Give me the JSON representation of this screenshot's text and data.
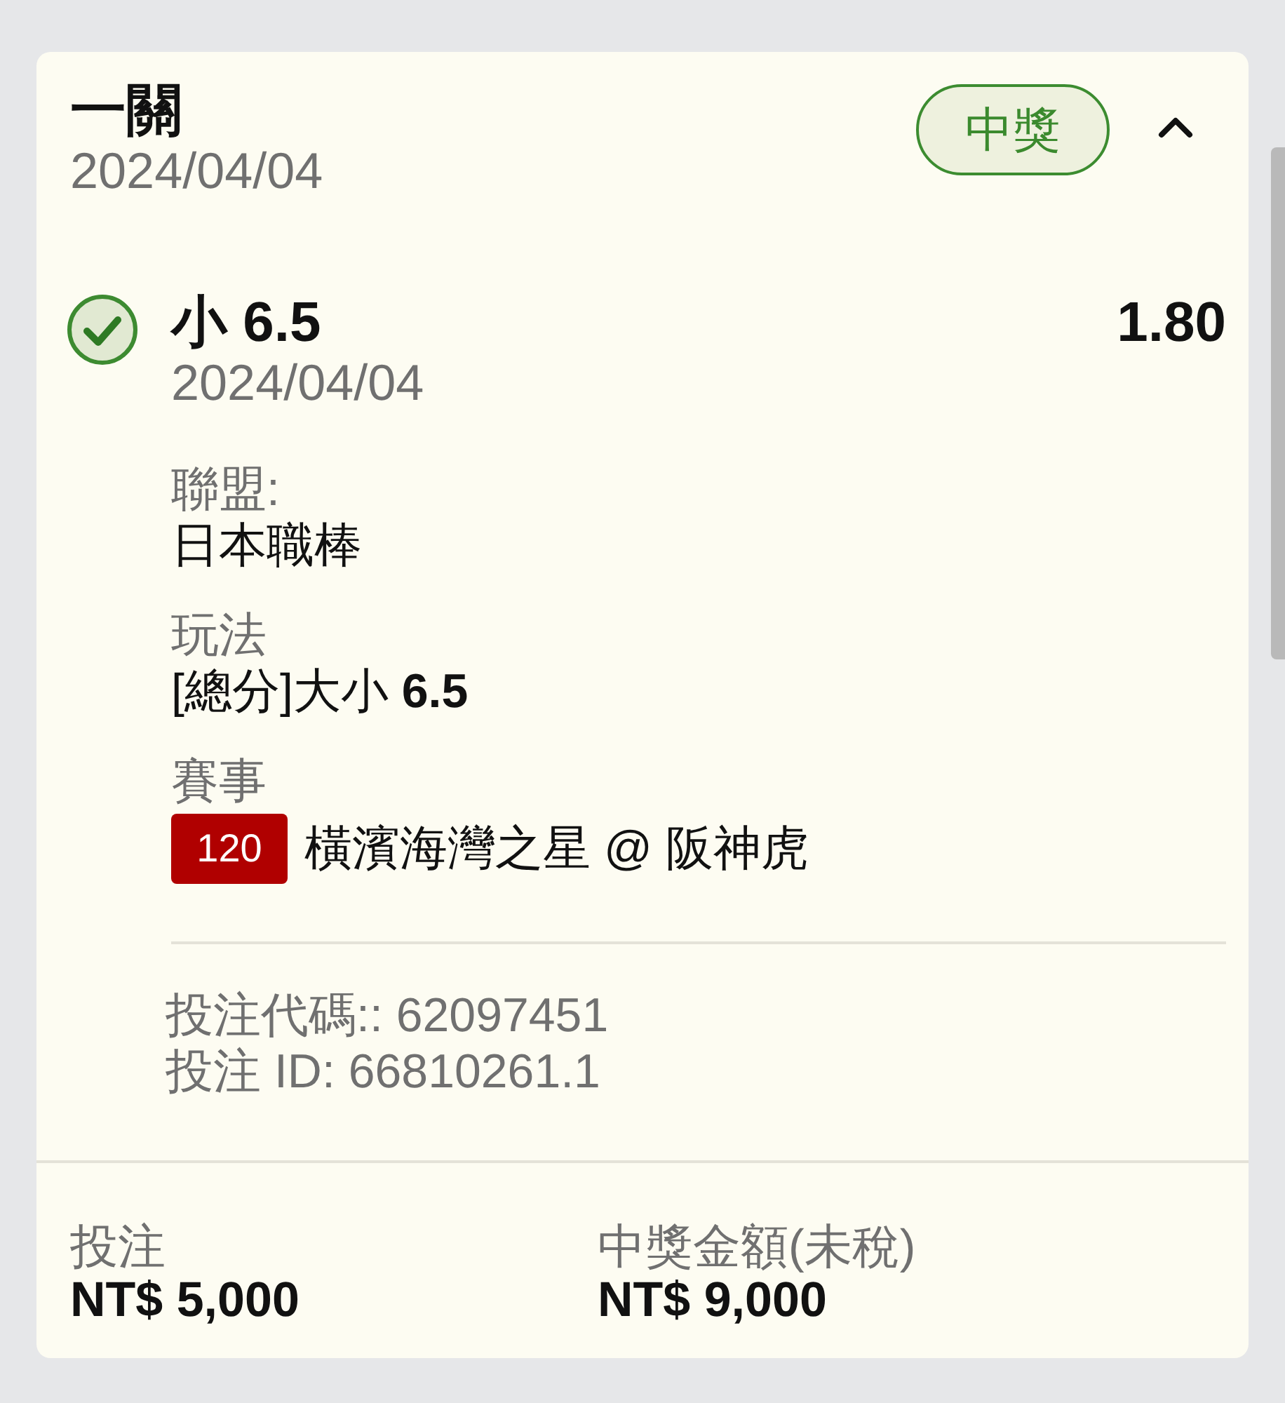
{
  "bet": {
    "title": "一關",
    "date": "2024/04/04",
    "status_badge": {
      "label": "中獎",
      "kind": "won"
    },
    "expanded": true
  },
  "selection": {
    "won": true,
    "pick": "小 6.5",
    "odds": "1.80",
    "date": "2024/04/04"
  },
  "details": [
    {
      "kind": "text",
      "label": "聯盟:",
      "value": "日本職棒"
    },
    {
      "kind": "text",
      "label": "玩法",
      "value": "[總分]大小 **6.5**"
    },
    {
      "kind": "event",
      "label": "賽事",
      "event_code": "120",
      "value": "橫濱海灣之星 @ 阪神虎"
    }
  ],
  "references": [
    "投注代碼:: 62097451",
    "投注 ID: 66810261.1"
  ],
  "summary": [
    {
      "label": "投注",
      "value": "NT$ 5,000"
    },
    {
      "label": "中獎金額(未稅)",
      "value": "NT$ 9,000"
    }
  ]
}
